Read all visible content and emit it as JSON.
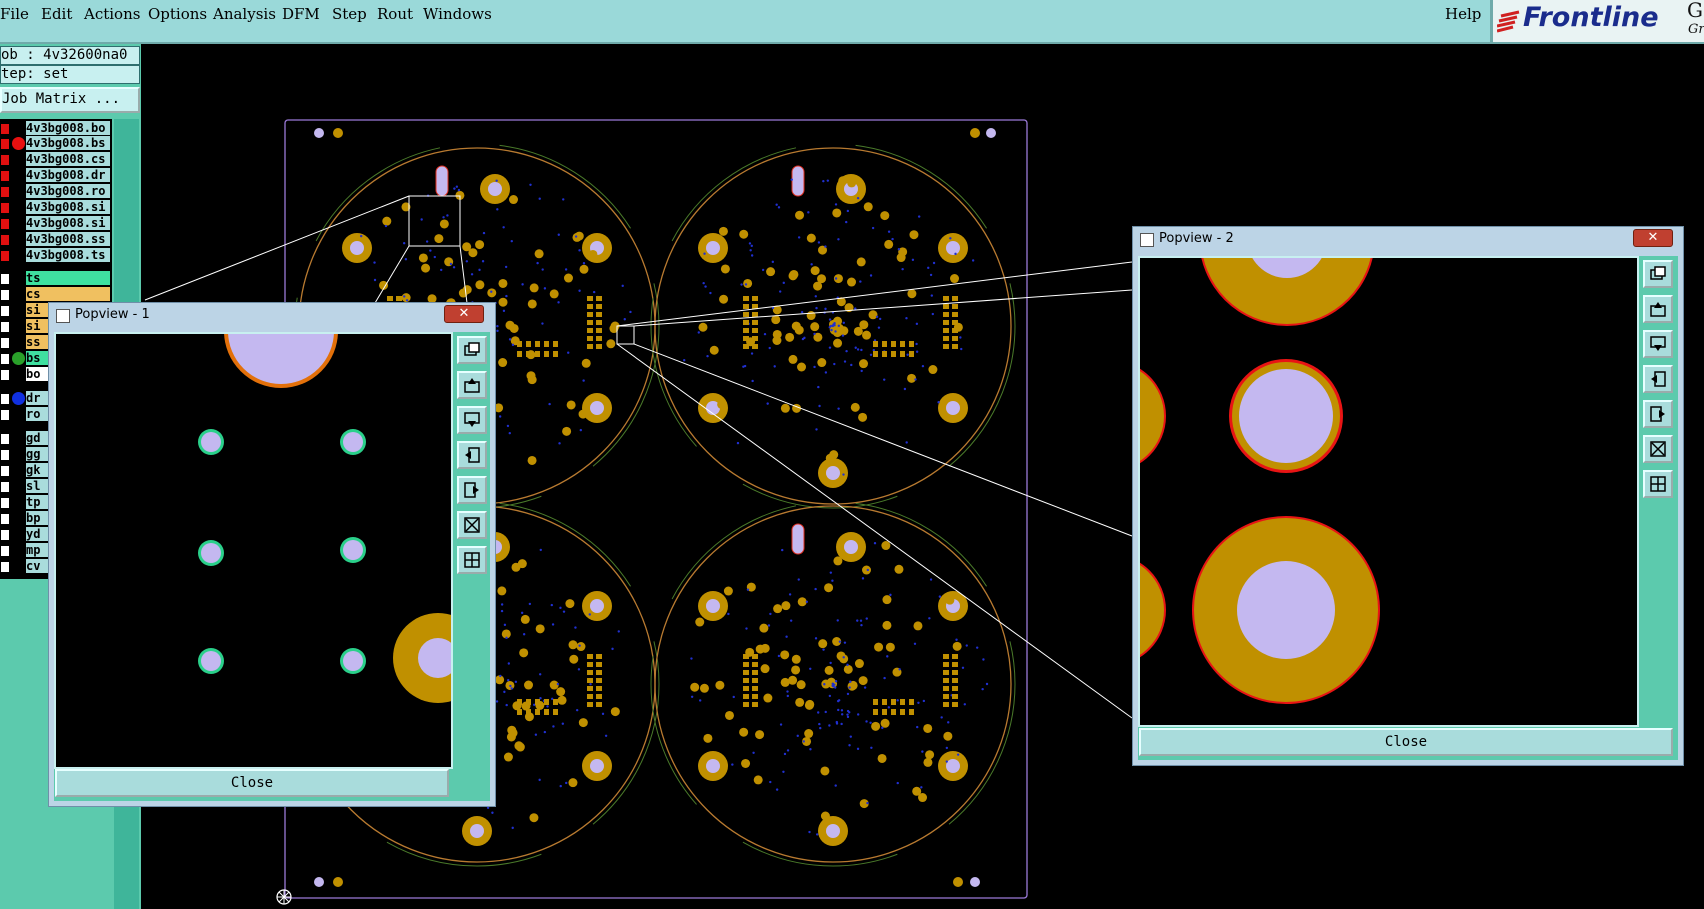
{
  "menubar": {
    "items": [
      "File",
      "Edit",
      "Actions",
      "Options",
      "Analysis",
      "DFM",
      "Step",
      "Rout",
      "Windows"
    ],
    "help": "Help"
  },
  "logo": {
    "text": "Frontline",
    "tail": "Gen",
    "sub": "Gr"
  },
  "job": {
    "job_label": "ob : 4v32600na0",
    "step_label": "tep: set",
    "matrix_button": "Job Matrix ..."
  },
  "layers": [
    {
      "name": "4v3bg008.bo"
    },
    {
      "name": "4v3bg008.bs"
    },
    {
      "name": "4v3bg008.cs"
    },
    {
      "name": "4v3bg008.dr"
    },
    {
      "name": "4v3bg008.ro"
    },
    {
      "name": "4v3bg008.si"
    },
    {
      "name": "4v3bg008.si"
    },
    {
      "name": "4v3bg008.ss"
    },
    {
      "name": "4v3bg008.ts"
    },
    {
      "name": "ts"
    },
    {
      "name": "cs"
    },
    {
      "name": "si"
    },
    {
      "name": "si"
    },
    {
      "name": "ss"
    },
    {
      "name": "bs"
    },
    {
      "name": "bo"
    },
    {
      "name": "dr"
    },
    {
      "name": "ro"
    },
    {
      "name": "gd"
    },
    {
      "name": "gg"
    },
    {
      "name": "gk"
    },
    {
      "name": "sl"
    },
    {
      "name": "tp"
    },
    {
      "name": "bp"
    },
    {
      "name": "yd"
    },
    {
      "name": "mp"
    },
    {
      "name": "cv"
    }
  ],
  "popup1": {
    "title": "Popview - 1",
    "close_x": "✕",
    "close_label": "Close"
  },
  "popup2": {
    "title": "Popview - 2",
    "close_x": "✕",
    "close_label": "Close"
  },
  "colors": {
    "menubar": "#9ad9d9",
    "panel": "#5ccaad",
    "pad": "#c09000",
    "hole": "#c4b8f0",
    "outline": "#b87a30"
  }
}
